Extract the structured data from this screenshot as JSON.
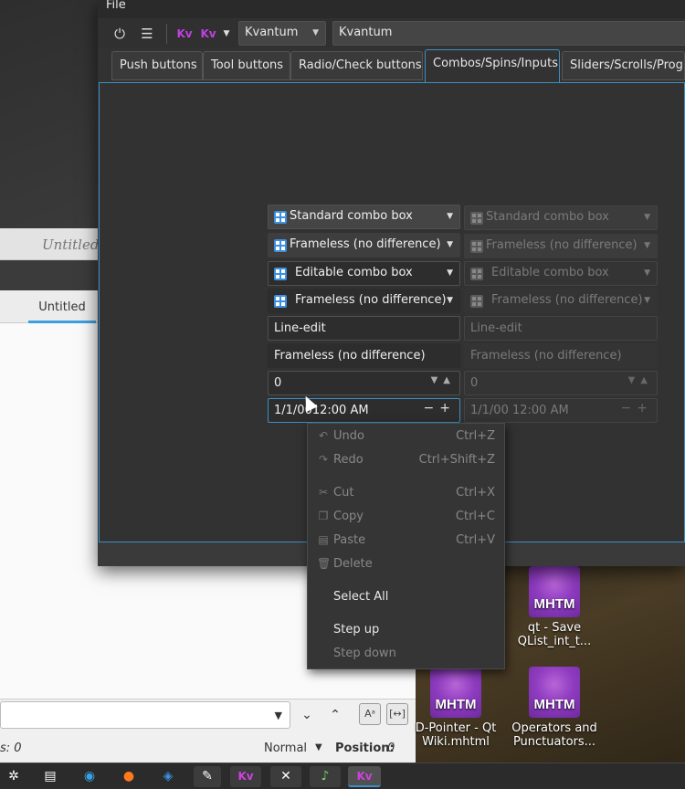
{
  "doc_window": {
    "title": "Untitled",
    "tab_label": "Untitled",
    "status_left": "s: 0",
    "status_mode": "Normal",
    "status_position_label": "Position:",
    "status_position_value": "0"
  },
  "main_window": {
    "menu": {
      "file": "File"
    },
    "toolbar": {
      "style_combo": "Kvantum",
      "theme_combo": "Kvantum"
    },
    "tabs": [
      {
        "label": "Push buttons"
      },
      {
        "label": "Tool buttons"
      },
      {
        "label": "Radio/Check buttons"
      },
      {
        "label": "Combos/Spins/Inputs"
      },
      {
        "label": "Sliders/Scrolls/Progr"
      }
    ],
    "active_tab": "Combos/Spins/Inputs",
    "widgets": {
      "standard_combo": "Standard combo box",
      "frameless_combo": "Frameless (no difference)",
      "editable_combo": "Editable combo box",
      "editable_frameless_combo": "Frameless (no difference)",
      "line_edit": "Line-edit",
      "line_edit_frameless": "Frameless (no difference)",
      "spin_value": "0",
      "datetime_value": "1/1/00 12:00 AM",
      "datetime_focused_value": "1/1/0012:00 AM"
    }
  },
  "context_menu": {
    "items": [
      {
        "label": "Undo",
        "shortcut": "Ctrl+Z",
        "icon": "undo-icon",
        "enabled": false
      },
      {
        "label": "Redo",
        "shortcut": "Ctrl+Shift+Z",
        "icon": "redo-icon",
        "enabled": false
      },
      {
        "label": "Cut",
        "shortcut": "Ctrl+X",
        "icon": "scissors-icon",
        "enabled": false
      },
      {
        "label": "Copy",
        "shortcut": "Ctrl+C",
        "icon": "copy-icon",
        "enabled": false
      },
      {
        "label": "Paste",
        "shortcut": "Ctrl+V",
        "icon": "paste-icon",
        "enabled": false
      },
      {
        "label": "Delete",
        "shortcut": "",
        "icon": "trash-icon",
        "enabled": false
      },
      {
        "label": "Select All",
        "shortcut": "",
        "enabled": true
      },
      {
        "label": "Step up",
        "shortcut": "",
        "enabled": true
      },
      {
        "label": "Step down",
        "shortcut": "",
        "enabled": false
      }
    ]
  },
  "desktop_icons": [
    {
      "badge": "MHTM",
      "label": "qt - Save QList_int_t..."
    },
    {
      "badge": "MHTM",
      "label": "D-Pointer - Qt Wiki.mhtml"
    },
    {
      "badge": "MHTM",
      "label": "Operators and Punctuators..."
    }
  ],
  "colors": {
    "accent": "#3d8fc4",
    "window_bg": "#323232",
    "mhtm_purple": "#8f3cc0"
  }
}
